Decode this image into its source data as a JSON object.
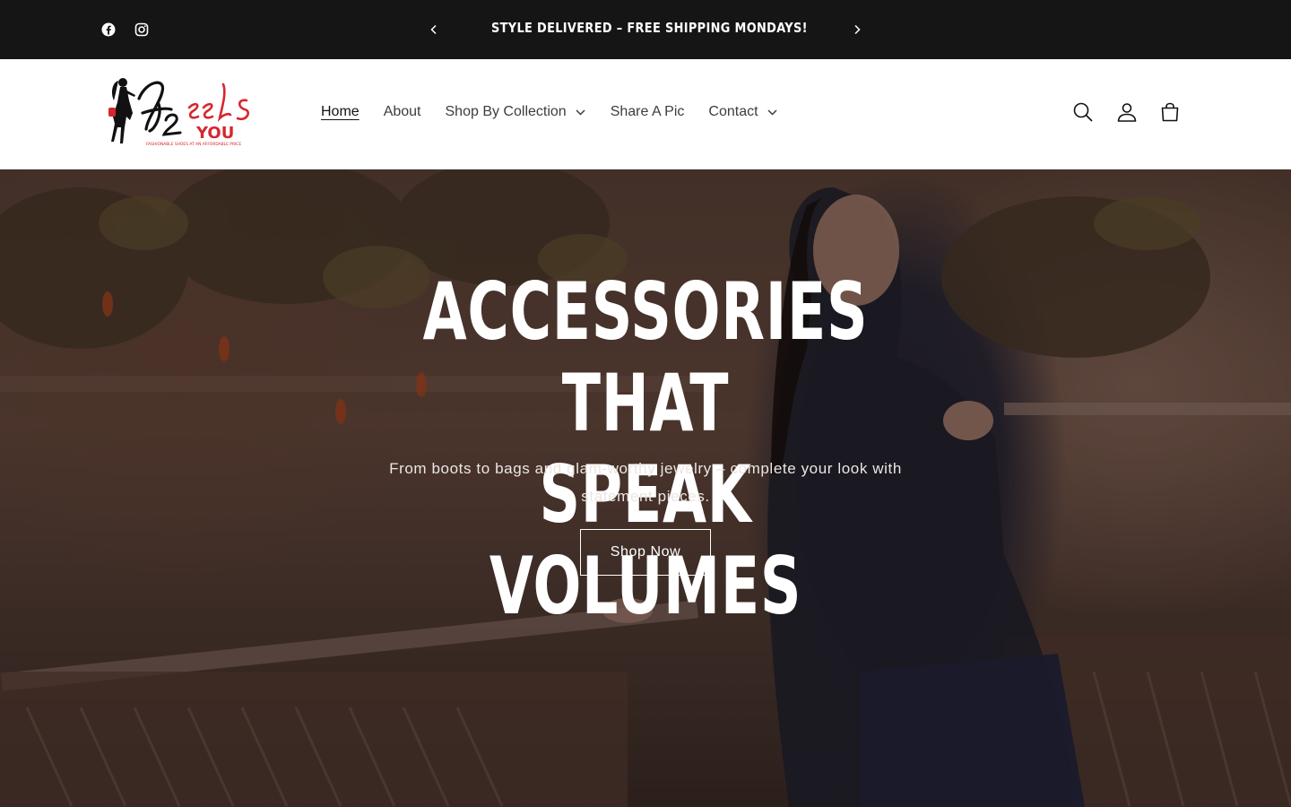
{
  "announcement": {
    "text": "STYLE DELIVERED – FREE SHIPPING MONDAYS!",
    "social": [
      {
        "icon": "facebook-icon"
      },
      {
        "icon": "instagram-icon"
      }
    ],
    "prev_icon": "chevron-left-icon",
    "next_icon": "chevron-right-icon"
  },
  "header": {
    "logo": {
      "wordmark": "Heels 2 You",
      "tagline": "FASHIONABLE SHOES AT AN AFFORDABLE PRICE"
    },
    "nav": [
      {
        "label": "Home",
        "active": true
      },
      {
        "label": "About"
      },
      {
        "label": "Shop By Collection",
        "dropdown": true
      },
      {
        "label": "Share A Pic"
      },
      {
        "label": "Contact",
        "dropdown": true
      }
    ],
    "icons": [
      "search-icon",
      "account-icon",
      "cart-icon"
    ]
  },
  "hero": {
    "heading_line1": "ACCESSORIES THAT",
    "heading_line2": "SPEAK VOLUMES",
    "subheading": "From boots to bags and glam-worthy jewelry – complete your look with statement pieces.",
    "button_label": "Shop Now"
  },
  "colors": {
    "announcement_bg": "#151515",
    "logo_red": "#d7262e",
    "text_dark": "#121212"
  }
}
